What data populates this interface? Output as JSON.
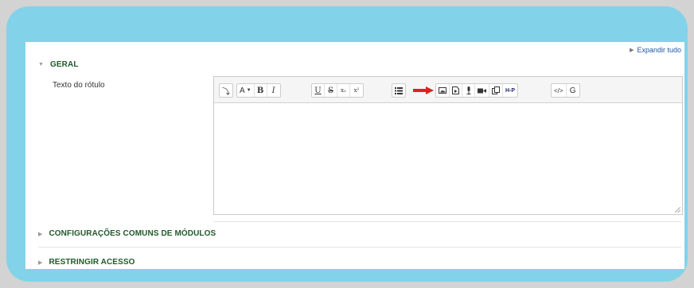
{
  "expand_all": "Expandir tudo",
  "sections": {
    "geral": "GERAL",
    "configuracoes": "CONFIGURAÇÕES COMUNS DE MÓDULOS",
    "restringir": "RESTRINGIR ACESSO"
  },
  "field": {
    "label": "Texto do rótulo"
  },
  "toolbar": {
    "toggle": "⤵",
    "font": "A",
    "bold": "B",
    "italic": "I",
    "underline": "U",
    "strike": "S",
    "subscript": "x₂",
    "superscript": "x²",
    "h5p": "H-P",
    "html": "</>",
    "g": "G"
  },
  "colors": {
    "arrow": "#e01f1f",
    "heading": "#1f5a2a",
    "link": "#1c5aa6",
    "frame": "#82d3e9"
  }
}
